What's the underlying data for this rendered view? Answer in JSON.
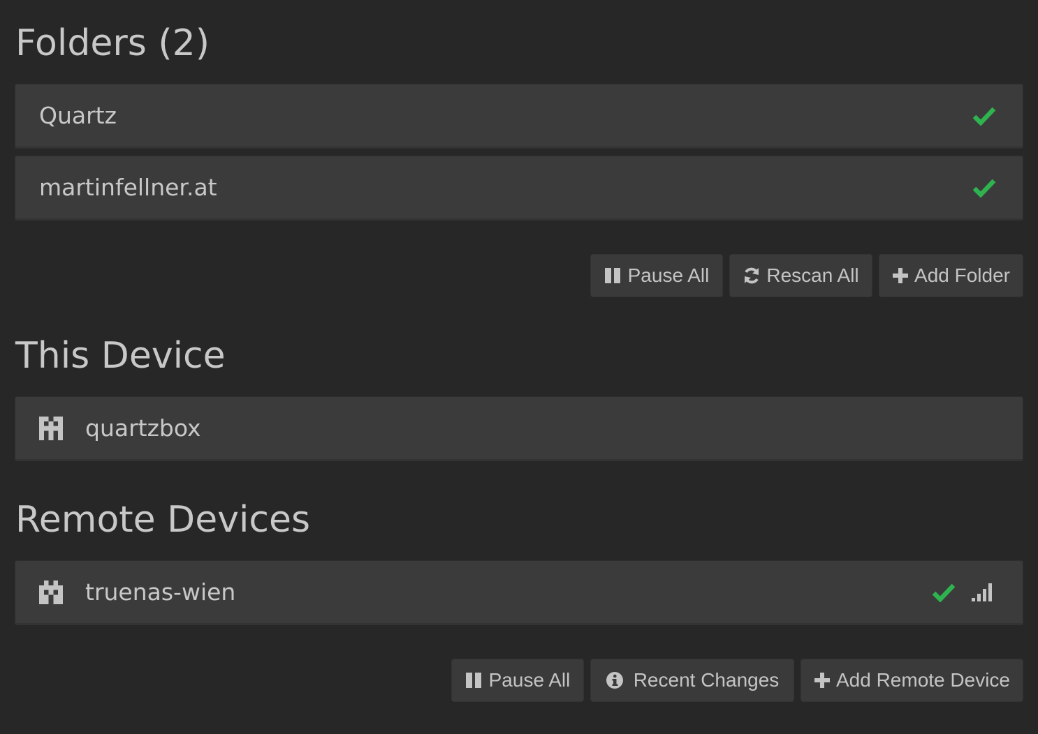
{
  "folders": {
    "heading": "Folders (2)",
    "items": [
      {
        "name": "Quartz",
        "status_icon": "check-icon"
      },
      {
        "name": "martinfellner.at",
        "status_icon": "check-icon"
      }
    ],
    "actions": {
      "pause_all": "Pause All",
      "rescan_all": "Rescan All",
      "add_folder": "Add Folder"
    }
  },
  "this_device": {
    "heading": "This Device",
    "name": "quartzbox",
    "icon": "identicon"
  },
  "remote_devices": {
    "heading": "Remote Devices",
    "items": [
      {
        "name": "truenas-wien",
        "status_icon": "check-icon",
        "signal_icon": "signal-bars-icon"
      }
    ],
    "actions": {
      "pause_all": "Pause All",
      "recent_changes": "Recent Changes",
      "add_remote_device": "Add Remote Device"
    }
  },
  "colors": {
    "background": "#272727",
    "panel": "#3b3b3b",
    "success": "#2fb34f",
    "text": "#c4c4c4"
  }
}
